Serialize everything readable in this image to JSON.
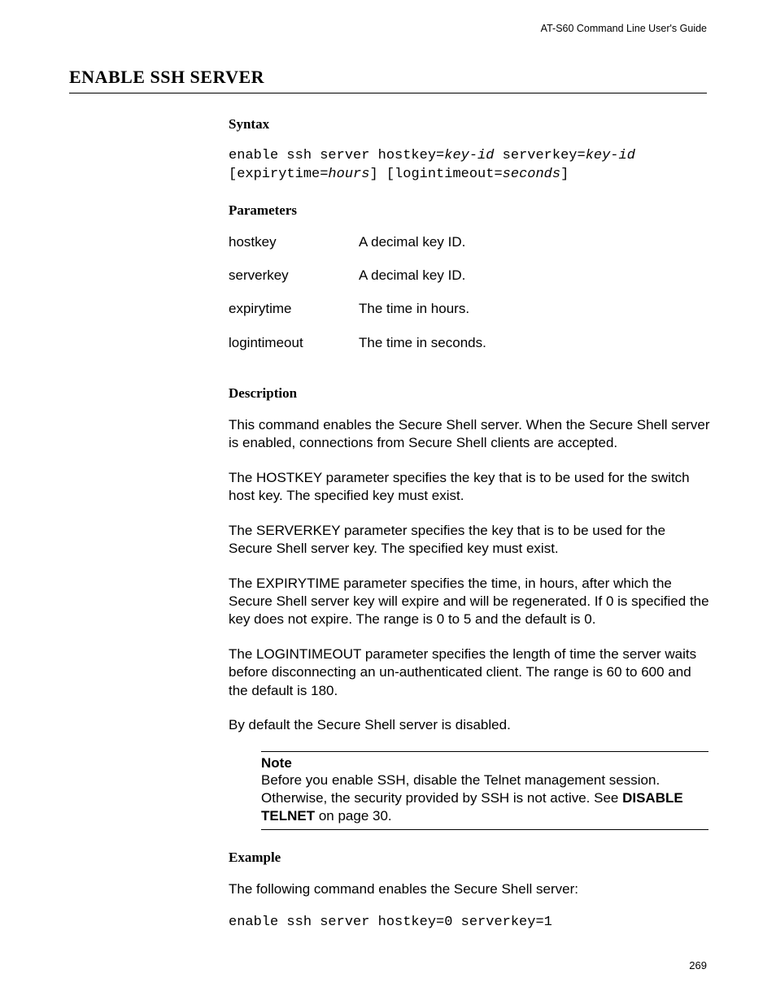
{
  "running_head": "AT-S60 Command Line User's Guide",
  "title": "ENABLE SSH SERVER",
  "sections": {
    "syntax_label": "Syntax",
    "parameters_label": "Parameters",
    "description_label": "Description",
    "example_label": "Example"
  },
  "syntax": {
    "t1": "enable ssh server hostkey=",
    "p1": "key-id",
    "t2": " serverkey=",
    "p2": "key-id",
    "t3": " [expirytime=",
    "p3": "hours",
    "t4": "] [logintimeout=",
    "p4": "seconds",
    "t5": "]"
  },
  "parameters": [
    {
      "name": "hostkey",
      "desc": "A decimal key ID."
    },
    {
      "name": "serverkey",
      "desc": "A decimal key ID."
    },
    {
      "name": "expirytime",
      "desc": "The time in hours."
    },
    {
      "name": "logintimeout",
      "desc": "The time in seconds."
    }
  ],
  "description": {
    "p1": "This command enables the Secure Shell server. When the Secure Shell server is enabled, connections from Secure Shell clients are accepted.",
    "p2": "The HOSTKEY parameter specifies the key that is to be used for the switch host key. The specified key must exist.",
    "p3": "The SERVERKEY parameter specifies the key that is to be used for the Secure Shell server key. The specified key must exist.",
    "p4": "The EXPIRYTIME parameter specifies the time, in hours, after which the Secure Shell server key will expire and will be regenerated. If 0 is specified the key does not expire. The range is 0 to 5 and the default is 0.",
    "p5": "The LOGINTIMEOUT parameter specifies the length of time the server waits before disconnecting an un-authenticated client. The range is 60 to 600 and the default is 180.",
    "p6": "By default the Secure Shell server is disabled."
  },
  "note": {
    "label": "Note",
    "text_before_xref": "Before you enable SSH, disable the Telnet management session. Otherwise, the security provided by SSH is not active. See ",
    "xref": "DISABLE TELNET",
    "text_after_xref": " on page 30."
  },
  "example": {
    "intro": "The following command enables the Secure Shell server:",
    "cmd": "enable ssh server hostkey=0 serverkey=1"
  },
  "page_number": "269"
}
